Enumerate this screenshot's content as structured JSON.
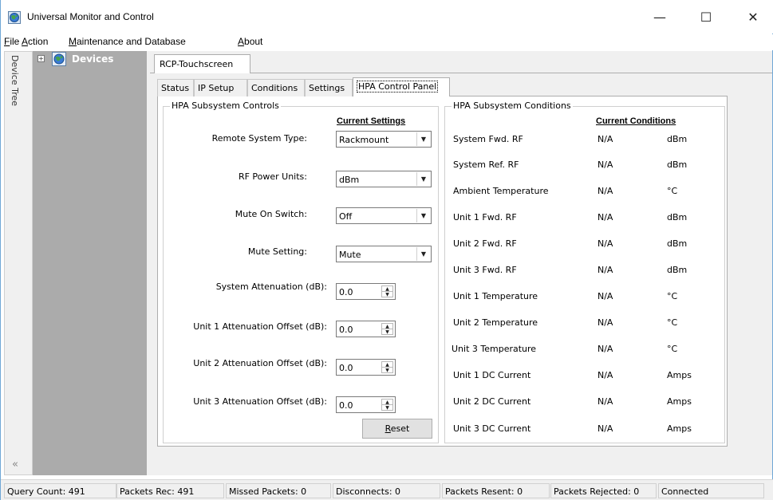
{
  "window": {
    "title": "Universal Monitor and Control",
    "controls": {
      "minimize": "—",
      "maximize": "☐",
      "close": "✕"
    }
  },
  "menu": [
    {
      "label_first": "F",
      "label_rest": "ile"
    },
    {
      "label_first": "A",
      "label_rest": "ction"
    },
    {
      "label_first": "M",
      "label_rest": "aintenance and Database"
    },
    {
      "label_first": "A",
      "label_rest": "bout"
    }
  ],
  "sidebar": {
    "strip_label": "Device Tree",
    "collapse_glyph": "«",
    "tree": {
      "expander": "+",
      "root_label": "Devices"
    }
  },
  "outer_tab": {
    "label": "RCP-Touchscreen"
  },
  "inner_tabs": [
    {
      "label": "Status",
      "active": false
    },
    {
      "label": "IP Setup",
      "active": false
    },
    {
      "label": "Conditions",
      "active": false
    },
    {
      "label": "Settings",
      "active": false
    },
    {
      "label": "HPA Control Panel",
      "active": true
    }
  ],
  "controls": {
    "title": "HPA Subsystem Controls",
    "column_header": "Current Settings",
    "combos": [
      {
        "label": "Remote System Type:",
        "value": "Rackmount"
      },
      {
        "label": "RF Power Units:",
        "value": "dBm"
      },
      {
        "label": "Mute On Switch:",
        "value": "Off"
      },
      {
        "label": "Mute Setting:",
        "value": "Mute"
      }
    ],
    "spinners": [
      {
        "label": "System Attenuation (dB):",
        "value": "0.0"
      },
      {
        "label": "Unit 1 Attenuation Offset (dB):",
        "value": "0.0"
      },
      {
        "label": "Unit 2 Attenuation Offset (dB):",
        "value": "0.0"
      },
      {
        "label": "Unit 3 Attenuation Offset (dB):",
        "value": "0.0"
      }
    ],
    "reset": {
      "first": "R",
      "rest": "eset"
    }
  },
  "conditions": {
    "title": "HPA Subsystem Conditions",
    "column_header": "Current Conditions",
    "rows": [
      {
        "name": "System Fwd. RF",
        "value": "N/A",
        "unit": "dBm"
      },
      {
        "name": "System Ref. RF",
        "value": "N/A",
        "unit": "dBm"
      },
      {
        "name": "Ambient Temperature",
        "value": "N/A",
        "unit": "°C"
      },
      {
        "name": "Unit 1 Fwd. RF",
        "value": "N/A",
        "unit": "dBm"
      },
      {
        "name": "Unit 2 Fwd. RF",
        "value": "N/A",
        "unit": "dBm"
      },
      {
        "name": "Unit 3 Fwd. RF",
        "value": "N/A",
        "unit": "dBm"
      },
      {
        "name": "Unit 1 Temperature",
        "value": "N/A",
        "unit": "°C"
      },
      {
        "name": "Unit 2 Temperature",
        "value": "N/A",
        "unit": "°C"
      },
      {
        "name": "Unit 3 Temperature",
        "value": "N/A",
        "unit": "°C"
      },
      {
        "name": "Unit 1 DC Current",
        "value": "N/A",
        "unit": "Amps"
      },
      {
        "name": "Unit 2 DC Current",
        "value": "N/A",
        "unit": "Amps"
      },
      {
        "name": "Unit 3 DC Current",
        "value": "N/A",
        "unit": "Amps"
      }
    ]
  },
  "status_bar": [
    "Query Count: 491",
    "Packets Rec: 491",
    "Missed Packets: 0",
    "Disconnects: 0",
    "Packets Resent: 0",
    "Packets Rejected: 0",
    "Connected"
  ]
}
